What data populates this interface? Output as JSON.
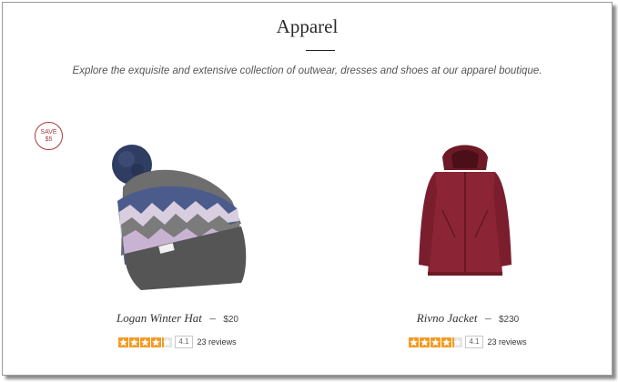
{
  "section": {
    "title": "Apparel",
    "subtitle": "Explore the exquisite and extensive collection of outwear, dresses and shoes at our apparel boutique."
  },
  "badge": {
    "line1": "SAVE",
    "line2": "$5"
  },
  "products": [
    {
      "name": "Logan Winter Hat",
      "separator": "–",
      "price": "$20",
      "rating": 4.1,
      "rating_label": "4.1",
      "reviews": "23 reviews",
      "image_icon": "winter-hat-icon"
    },
    {
      "name": "Rivno Jacket",
      "separator": "–",
      "price": "$230",
      "rating": 4.1,
      "rating_label": "4.1",
      "reviews": "23 reviews",
      "image_icon": "jacket-icon"
    }
  ],
  "colors": {
    "star": "#f59a23",
    "star_empty": "#e4e4e4",
    "badge": "#a83a3a"
  }
}
